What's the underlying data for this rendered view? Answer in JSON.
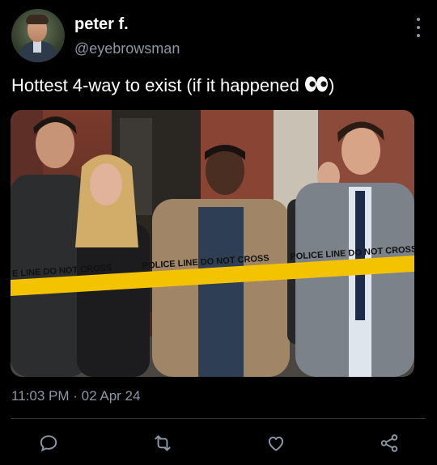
{
  "author": {
    "display_name": "peter f.",
    "handle": "@eyebrowsman"
  },
  "tweet": {
    "text": "Hottest 4-way to exist (if it happened",
    "text_end": ")",
    "emoji": "eyes-emoji"
  },
  "media": {
    "tape_segments": [
      "E LINE DO NOT CROSS",
      "POLICE LINE DO NOT CROSS",
      "POLICE LINE DO NOT CROSS"
    ]
  },
  "meta": {
    "time": "11:03 PM",
    "separator": "·",
    "date": "02 Apr 24"
  },
  "actions": {
    "reply_icon": "reply-icon",
    "retweet_icon": "retweet-icon",
    "like_icon": "heart-icon",
    "share_icon": "share-icon"
  },
  "colors": {
    "background": "#000000",
    "primary_text": "#ffffff",
    "secondary_text": "#8b98a5",
    "icon": "#8b98a5",
    "tape": "#f3c300"
  }
}
